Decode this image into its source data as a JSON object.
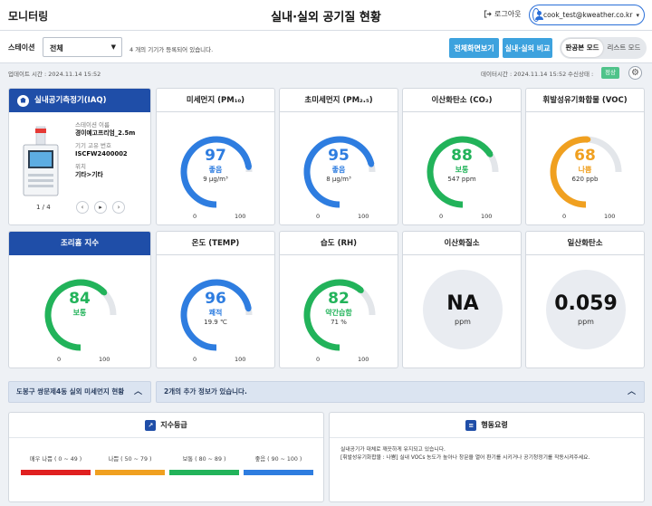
{
  "header": {
    "title": "모니터링",
    "center_title": "실내·실외 공기질 현황",
    "logout": "로그아웃",
    "user_email": "cook_test@kweather.co.kr"
  },
  "toolbar": {
    "station_label": "스테이션",
    "station_select": "전체",
    "notice": "4 개의 기기가 등록되어 있습니다.",
    "btn_full": "전체화면보기",
    "btn_compare": "실내·실외 비교",
    "mode_pan": "판공본 모드",
    "mode_list": "리스트 모드"
  },
  "status": {
    "update_time": "업데이트 시간 : 2024.11.14 15:52",
    "data_time": "데이터시간 : 2024.11.14 15:52",
    "recv_label": "수신상태 :",
    "recv_badge": "정상"
  },
  "iaq": {
    "title": "실내공기측정기(IAQ)",
    "station_name_label": "스테이션 이름",
    "station_name": "경이예고프리엄_2.5m",
    "serial_label": "기기 고유 번호",
    "serial": "ISCFW2400002",
    "location_label": "위치",
    "location": "기타>기타",
    "pager": "1 / 4"
  },
  "gauges": [
    {
      "id": "pm10",
      "title": "미세먼지 (PM₁₀)",
      "value": "97",
      "grade": "좋음",
      "sub": "9 μg/m³",
      "min": "0",
      "max": "100",
      "fill": 0.97,
      "color": "#2e7de0"
    },
    {
      "id": "pm25",
      "title": "초미세먼지 (PM₂.₅)",
      "value": "95",
      "grade": "좋음",
      "sub": "8 μg/m³",
      "min": "0",
      "max": "100",
      "fill": 0.95,
      "color": "#2e7de0"
    },
    {
      "id": "co2",
      "title": "이산화탄소 (CO₂)",
      "value": "88",
      "grade": "보통",
      "sub": "547 ppm",
      "min": "0",
      "max": "100",
      "fill": 0.88,
      "color": "#22b35a"
    },
    {
      "id": "voc",
      "title": "휘발성유기화합물 (VOC)",
      "value": "68",
      "grade": "나쁨",
      "sub": "620 ppb",
      "min": "0",
      "max": "100",
      "fill": 0.68,
      "color": "#f0a020"
    },
    {
      "id": "cfi",
      "title": "조리흄 지수",
      "value": "84",
      "grade": "보통",
      "sub": "",
      "min": "0",
      "max": "100",
      "fill": 0.84,
      "color": "#22b35a"
    },
    {
      "id": "temp",
      "title": "온도 (TEMP)",
      "value": "96",
      "grade": "쾌적",
      "sub": "19.9 ℃",
      "min": "0",
      "max": "100",
      "fill": 0.96,
      "color": "#2e7de0"
    },
    {
      "id": "rh",
      "title": "습도 (RH)",
      "value": "82",
      "grade": "약간습함",
      "sub": "71 %",
      "min": "0",
      "max": "100",
      "fill": 0.82,
      "color": "#22b35a"
    }
  ],
  "no2": {
    "title": "이산화질소",
    "value": "NA",
    "unit": "ppm"
  },
  "co": {
    "title": "일산화탄소",
    "value": "0.059",
    "unit": "ppm"
  },
  "bars": {
    "left": "도봉구 쌍문제4동 실외 미세먼지 현황",
    "right": "2개의 추가 정보가 있습니다."
  },
  "index_panel": {
    "title": "지수등급",
    "legend": [
      {
        "label": "매우 나쁨 ( 0 ~ 49 )",
        "color": "#e02020"
      },
      {
        "label": "나쁨 ( 50 ~ 79 )",
        "color": "#f0a020"
      },
      {
        "label": "보통 ( 80 ~ 89 )",
        "color": "#22b35a"
      },
      {
        "label": "좋음 ( 90 ~ 100 )",
        "color": "#2e7de0"
      }
    ]
  },
  "guide_panel": {
    "title": "행동요령",
    "line1": "실내공기가 대체로 깨끗하게 유지되고 있습니다.",
    "line2": "[휘발성유기화합물 : 나쁨] 실내 VOCs 농도가 높아나 창문을 열어 환기를 시키거나 공기청정기를 작동시켜주세요."
  }
}
